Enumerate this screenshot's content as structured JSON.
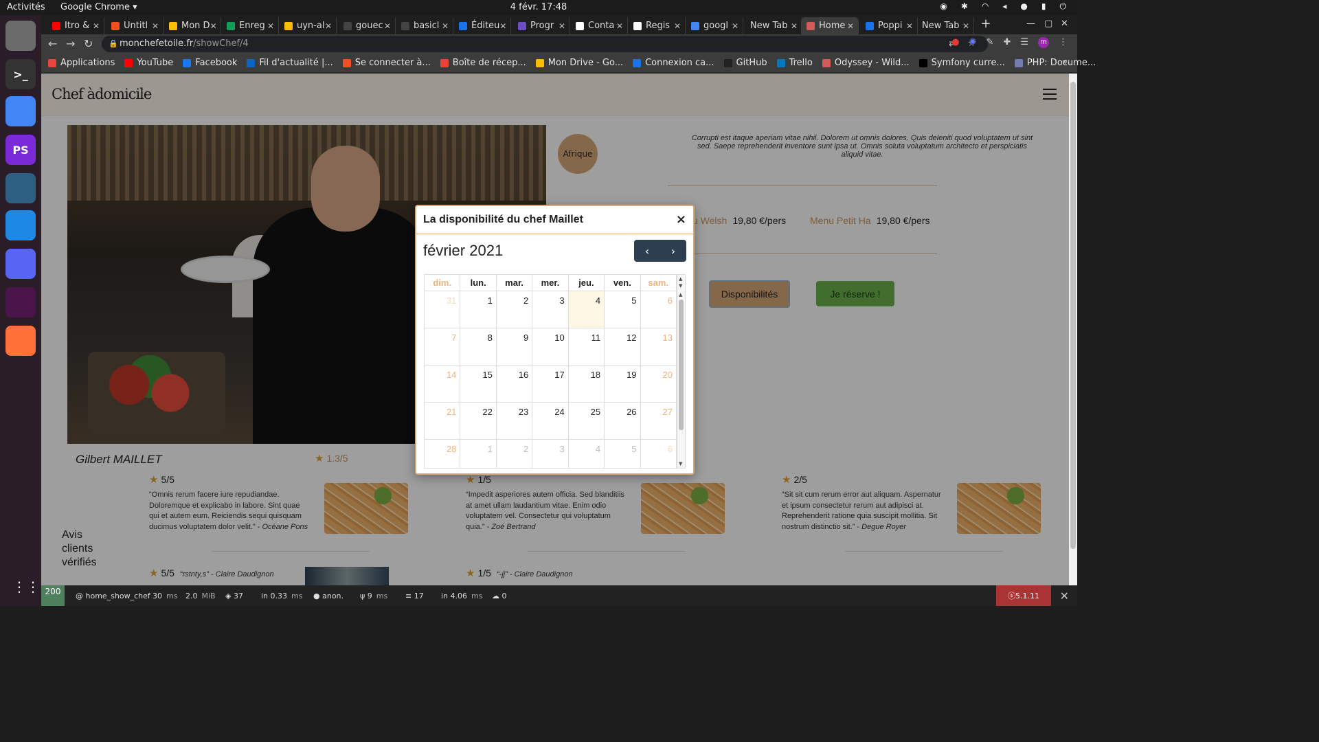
{
  "os": {
    "activities": "Activités",
    "app_name": "Google Chrome ▾",
    "clock": "4 févr.  17:48",
    "dock": [
      {
        "name": "files",
        "label": "",
        "color": "#6b6b6b"
      },
      {
        "name": "terminal",
        "label": ">_",
        "color": "#333333"
      },
      {
        "name": "chrome",
        "label": "",
        "color": "#4285f4"
      },
      {
        "name": "phpstorm",
        "label": "PS",
        "color": "#7b2ad8"
      },
      {
        "name": "mysql-workbench",
        "label": "",
        "color": "#2d5f82"
      },
      {
        "name": "vscode",
        "label": "",
        "color": "#1e88e5"
      },
      {
        "name": "discord",
        "label": "",
        "color": "#5865f2"
      },
      {
        "name": "slack",
        "label": "",
        "color": "#4a154b"
      },
      {
        "name": "firefox",
        "label": "",
        "color": "#ff7139"
      }
    ]
  },
  "browser": {
    "tabs": [
      {
        "label": "Itro &",
        "color": "#ff0000"
      },
      {
        "label": "Untitl",
        "color": "#f24e1e"
      },
      {
        "label": "Mon D",
        "color": "#fbbc04"
      },
      {
        "label": "Enreg",
        "color": "#0f9d58"
      },
      {
        "label": "uyn-al",
        "color": "#fbbc04"
      },
      {
        "label": "gouec",
        "color": "#444444"
      },
      {
        "label": "basicl",
        "color": "#444444"
      },
      {
        "label": "Éditeu",
        "color": "#1a73e8"
      },
      {
        "label": "Progr",
        "color": "#6c4cc2"
      },
      {
        "label": "Conta",
        "color": "#ffffff"
      },
      {
        "label": "Regis",
        "color": "#ffffff"
      },
      {
        "label": "googl",
        "color": "#4285f4"
      },
      {
        "label": "New Tab",
        "color": ""
      },
      {
        "label": "Home",
        "color": "#d45a5a"
      },
      {
        "label": "Poppi",
        "color": "#1a73e8"
      },
      {
        "label": "New Tab",
        "color": ""
      }
    ],
    "url_host": "monchefetoile.fr",
    "url_path": "/showChef/4",
    "bookmarks": [
      {
        "label": "Applications",
        "color": "#e8453c"
      },
      {
        "label": "YouTube",
        "color": "#ff0000"
      },
      {
        "label": "Facebook",
        "color": "#1877f2"
      },
      {
        "label": "Fil d'actualité |...",
        "color": "#0a66c2"
      },
      {
        "label": "Se connecter à...",
        "color": "#f25022"
      },
      {
        "label": "Boîte de récep...",
        "color": "#ea4335"
      },
      {
        "label": "Mon Drive - Go...",
        "color": "#fbbc04"
      },
      {
        "label": "Connexion ca...",
        "color": "#1a73e8"
      },
      {
        "label": "GitHub",
        "color": "#222222"
      },
      {
        "label": "Trello",
        "color": "#0079bf"
      },
      {
        "label": "Odyssey - Wild...",
        "color": "#d45a5a"
      },
      {
        "label": "Symfony curre...",
        "color": "#000000"
      },
      {
        "label": "PHP: Docume...",
        "color": "#777bb3"
      }
    ],
    "bookmarks_more": "»"
  },
  "site": {
    "brand": "Chef àdomicile",
    "region": "Afrique",
    "description": "Corrupti est itaque aperiam vitae nihil. Dolorem ut omnis dolores. Quis deleniti quod voluptatem ut sint sed. Saepe reprehenderit inventore sunt ipsa ut. Omnis soluta voluptatum architecto et perspiciatis aliquid vitae.",
    "menus": [
      {
        "name": "u Welsh",
        "price": "19,80 €/pers"
      },
      {
        "name": "Menu Petit Ha",
        "price": "19,80 €/pers"
      }
    ],
    "btn_dispo": "Disponibilités",
    "btn_reserve": "Je réserve !",
    "chef_name": "Gilbert MAILLET",
    "chef_rating": "1.3/5",
    "avis_title": "Avis clients vérifiés",
    "reviews": [
      {
        "score": "5/5",
        "text": "“Omnis rerum facere iure repudiandae. Doloremque et explicabo in labore. Sint quae qui et autem eum. Reiciendis sequi quisquam ducimus voluptatem dolor velit.” - ",
        "author": "Océane Pons"
      },
      {
        "score": "1/5",
        "text": "“Impedit asperiores autem officia. Sed blanditiis at amet ullam laudantium vitae. Enim odio voluptatem vel. Consectetur qui voluptatum quia.” - ",
        "author": "Zoé Bertrand"
      },
      {
        "score": "2/5",
        "text": "“Sit sit cum rerum error aut aliquam. Aspernatur et ipsum consectetur rerum aut adipisci at. Reprehenderit ratione quia suscipit mollitia. Sit nostrum distinctio sit.” - ",
        "author": "Degue Royer"
      }
    ],
    "small_reviews": [
      {
        "score": "5/5",
        "text": "“rstnty,s” - Claire Daudignon"
      },
      {
        "score": "1/5",
        "text": "“-jj” - Claire Daudignon"
      }
    ]
  },
  "modal": {
    "title": "La disponibilité du chef Maillet",
    "close": "×",
    "month": "février 2021",
    "prev": "‹",
    "next": "›",
    "weekdays": [
      "dim.",
      "lun.",
      "mar.",
      "mer.",
      "jeu.",
      "ven.",
      "sam."
    ],
    "weeks": [
      [
        "31",
        "1",
        "2",
        "3",
        "4",
        "5",
        "6"
      ],
      [
        "7",
        "8",
        "9",
        "10",
        "11",
        "12",
        "13"
      ],
      [
        "14",
        "15",
        "16",
        "17",
        "18",
        "19",
        "20"
      ],
      [
        "21",
        "22",
        "23",
        "24",
        "25",
        "26",
        "27"
      ],
      [
        "28",
        "1",
        "2",
        "3",
        "4",
        "5",
        "6"
      ]
    ],
    "today": "4"
  },
  "profiler": {
    "status": "200",
    "route": "@ home_show_chef",
    "time": "30",
    "time_unit": "ms",
    "memory": "2.0",
    "memory_unit": "MiB",
    "layers": "37",
    "layers_time": "in 0.33",
    "layers_unit": "ms",
    "user": "anon.",
    "events": "9",
    "events_unit": "ms",
    "db": "17",
    "db_time": "in 4.06",
    "db_unit": "ms",
    "cache": "0",
    "version": "5.1.11"
  }
}
